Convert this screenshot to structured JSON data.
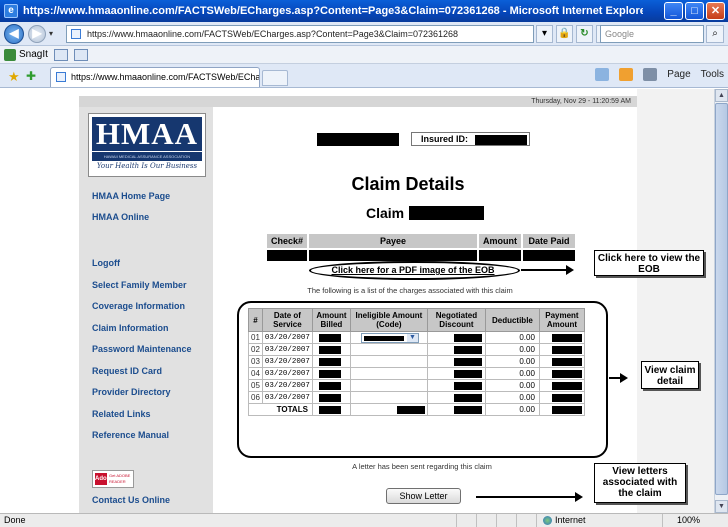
{
  "window": {
    "title": "https://www.hmaaonline.com/FACTSWeb/ECharges.asp?Content=Page3&Claim=072361268 - Microsoft Internet Explorer provided by HMAA",
    "address": "https://www.hmaaonline.com/FACTSWeb/ECharges.asp?Content=Page3&Claim=072361268",
    "search_placeholder": "Google",
    "tab_title": "https://www.hmaaonline.com/FACTSWeb/ECharges....",
    "links_bar": {
      "snagit": "SnagIt"
    },
    "commands": {
      "page": "Page",
      "tools": "Tools"
    },
    "status": {
      "text": "Done",
      "zone": "Internet",
      "zoom": "100%"
    }
  },
  "page": {
    "date_line": "Thursday, Nov 29 - 11:20:59 AM",
    "logo": {
      "word": "HMAA",
      "sub": "HAWAII MEDICAL ASSURANCE ASSOCIATION",
      "tagline": "Your Health Is Our Business"
    },
    "nav": {
      "home": "HMAA Home Page",
      "online": "HMAA Online",
      "logoff": "Logoff",
      "family": "Select Family Member",
      "coverage": "Coverage Information",
      "claim_info": "Claim Information",
      "password": "Password Maintenance",
      "id_card": "Request ID Card",
      "provider": "Provider Directory",
      "related": "Related Links",
      "reference": "Reference Manual",
      "contact": "Contact Us Online"
    },
    "adobe_badge": {
      "logo": "Adobe",
      "text": "Get ADOBE READER"
    },
    "insured_label": "Insured ID:",
    "heading": "Claim Details",
    "claim_label": "Claim",
    "payment_table": {
      "headers": {
        "check": "Check#",
        "payee": "Payee",
        "amount": "Amount",
        "date": "Date Paid"
      }
    },
    "pdf_link": "Click here for a PDF image of the EOB",
    "charges_intro": "The following is a list of the charges associated with this claim",
    "charges": {
      "headers": {
        "num": "#",
        "date": "Date of Service",
        "billed": "Amount Billed",
        "ineligible": "Ineligible Amount (Code)",
        "negotiated": "Negotiated Discount",
        "deductible": "Deductible",
        "payment": "Payment Amount"
      },
      "rows": [
        {
          "num": "01",
          "date": "03/20/2007",
          "deductible": "0.00"
        },
        {
          "num": "02",
          "date": "03/20/2007",
          "deductible": "0.00"
        },
        {
          "num": "03",
          "date": "03/20/2007",
          "deductible": "0.00"
        },
        {
          "num": "04",
          "date": "03/20/2007",
          "deductible": "0.00"
        },
        {
          "num": "05",
          "date": "03/20/2007",
          "deductible": "0.00"
        },
        {
          "num": "06",
          "date": "03/20/2007",
          "deductible": "0.00"
        }
      ],
      "totals": {
        "label": "TOTALS",
        "deductible": "0.00"
      }
    },
    "letter_text": "A letter has been sent regarding this claim",
    "letter_button": "Show Letter",
    "callouts": {
      "eob": "Click here to view the EOB",
      "detail": "View claim detail",
      "letters": "View letters associated with the claim"
    }
  }
}
